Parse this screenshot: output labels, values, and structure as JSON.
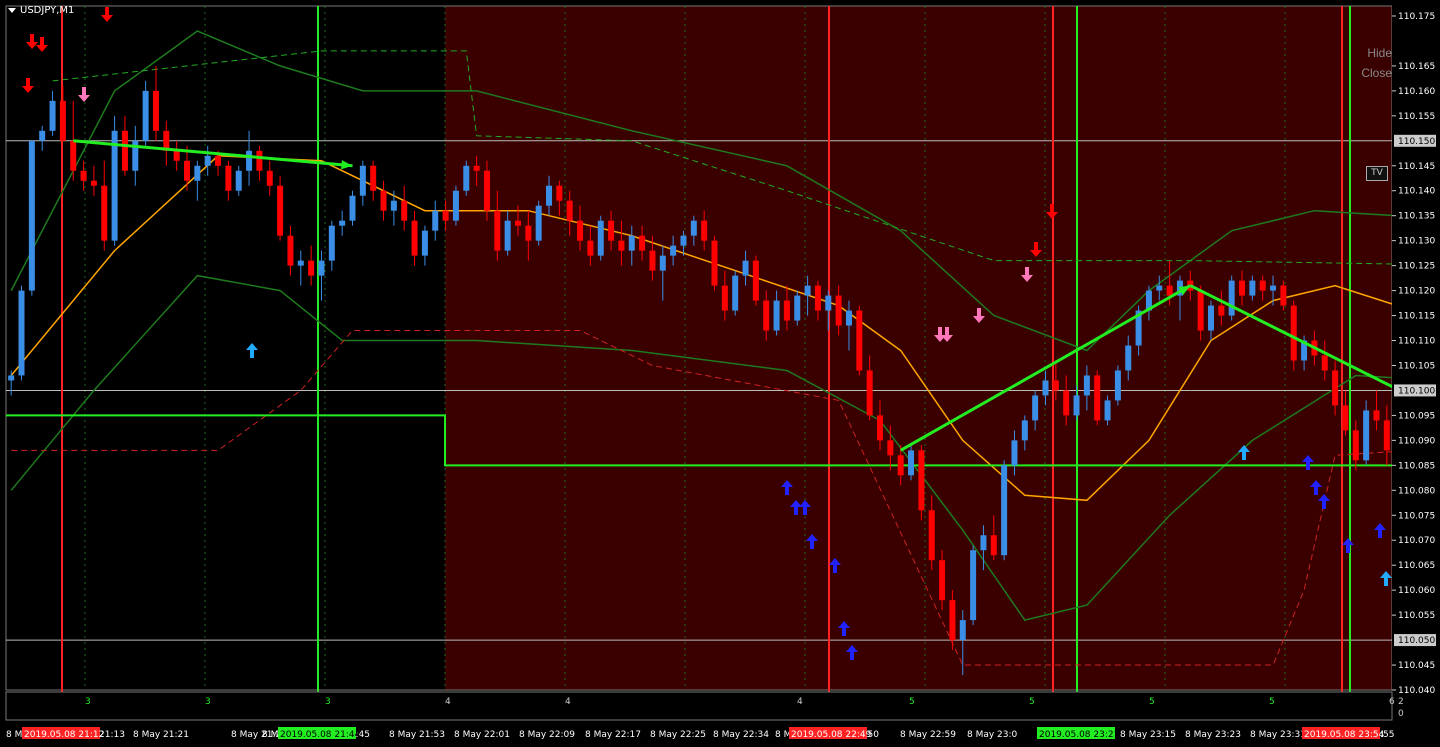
{
  "window": {
    "symbol_label": "USDJPY,M1"
  },
  "overlay_links": {
    "hide": "Hide",
    "close": "Close"
  },
  "tv_badge": "TV",
  "colors": {
    "background": "#000000",
    "shaded_bg": "#3a0000",
    "bull_candle": "#3a8ee6",
    "bear_candle": "#ff0000",
    "ma_orange": "#ffa500",
    "band_green": "#1e7a1e",
    "highlight_green": "#22ee22",
    "marker_red": "#ff0000",
    "marker_blue": "#2222ff",
    "marker_cyan": "#22aaff",
    "marker_pink": "#ff77bb"
  },
  "chart_data": {
    "type": "candlestick",
    "symbol": "USDJPY",
    "timeframe": "M1",
    "ylim": [
      110.04,
      110.177
    ],
    "y_ticks": [
      "110.175",
      "110.165",
      "110.160",
      "110.155",
      "110.145",
      "110.140",
      "110.135",
      "110.130",
      "110.125",
      "110.120",
      "110.115",
      "110.110",
      "110.105",
      "110.095",
      "110.090",
      "110.085",
      "110.080",
      "110.075",
      "110.070",
      "110.065",
      "110.060",
      "110.055",
      "110.045",
      "110.040"
    ],
    "horizontal_levels": [
      "110.150",
      "110.100",
      "110.050"
    ],
    "x_tick_labels": [
      "8 M",
      "21:13",
      "8 May 21:21",
      "8 May 21:29",
      "8 M",
      "21:45",
      "8 May 21:53",
      "8 May 22:01",
      "8 May 22:09",
      "8 May 22:17",
      "8 May 22:25",
      "8 May 22:34",
      "8 M",
      "22:50",
      "8 May 22:59",
      "8 May 23:0",
      "8 May 23:15",
      "8 May 23:23",
      "8 May 23:31",
      "8 May 23:39",
      "8 M",
      ":55"
    ],
    "highlighted_times": [
      "2019.05.08 21:12",
      "2019.05.08 21:44",
      "2019.05.08 22:49",
      "2019.05.08 23:21",
      "2019.05.08 23:54"
    ],
    "sub_indicator_labels": [
      "3",
      "3",
      "3",
      "4",
      "4",
      "4",
      "5",
      "5",
      "5",
      "5",
      "6",
      "2",
      "0"
    ],
    "ohlc": [
      [
        110.102,
        110.104,
        110.099,
        110.103
      ],
      [
        110.103,
        110.121,
        110.102,
        110.12
      ],
      [
        110.12,
        110.15,
        110.119,
        110.15
      ],
      [
        110.15,
        110.153,
        110.148,
        110.152
      ],
      [
        110.152,
        110.16,
        110.151,
        110.158
      ],
      [
        110.158,
        110.161,
        110.15,
        110.15
      ],
      [
        110.15,
        110.158,
        110.142,
        110.144
      ],
      [
        110.144,
        110.146,
        110.14,
        110.142
      ],
      [
        110.142,
        110.145,
        110.139,
        110.141
      ],
      [
        110.141,
        110.146,
        110.128,
        110.13
      ],
      [
        110.13,
        110.155,
        110.129,
        110.152
      ],
      [
        110.152,
        110.155,
        110.143,
        110.144
      ],
      [
        110.144,
        110.153,
        110.141,
        110.15
      ],
      [
        110.15,
        110.162,
        110.149,
        110.16
      ],
      [
        110.16,
        110.165,
        110.15,
        110.152
      ],
      [
        110.152,
        110.154,
        110.145,
        110.148
      ],
      [
        110.148,
        110.15,
        110.144,
        110.146
      ],
      [
        110.146,
        110.149,
        110.14,
        110.142
      ],
      [
        110.142,
        110.146,
        110.138,
        110.145
      ],
      [
        110.145,
        110.149,
        110.143,
        110.147
      ],
      [
        110.147,
        110.148,
        110.143,
        110.145
      ],
      [
        110.145,
        110.146,
        110.138,
        110.14
      ],
      [
        110.14,
        110.145,
        110.139,
        110.144
      ],
      [
        110.144,
        110.152,
        110.141,
        110.148
      ],
      [
        110.148,
        110.149,
        110.142,
        110.144
      ],
      [
        110.144,
        110.146,
        110.139,
        110.141
      ],
      [
        110.141,
        110.143,
        110.13,
        110.131
      ],
      [
        110.131,
        110.133,
        110.123,
        110.125
      ],
      [
        110.125,
        110.128,
        110.121,
        110.126
      ],
      [
        110.126,
        110.129,
        110.121,
        110.123
      ],
      [
        110.123,
        110.128,
        110.118,
        110.126
      ],
      [
        110.126,
        110.134,
        110.124,
        110.133
      ],
      [
        110.133,
        110.136,
        110.131,
        110.134
      ],
      [
        110.134,
        110.14,
        110.133,
        110.139
      ],
      [
        110.139,
        110.146,
        110.137,
        110.145
      ],
      [
        110.145,
        110.146,
        110.138,
        110.14
      ],
      [
        110.14,
        110.142,
        110.134,
        110.136
      ],
      [
        110.136,
        110.14,
        110.133,
        110.138
      ],
      [
        110.138,
        110.141,
        110.132,
        110.134
      ],
      [
        110.134,
        110.136,
        110.125,
        110.127
      ],
      [
        110.127,
        110.133,
        110.125,
        110.132
      ],
      [
        110.132,
        110.138,
        110.13,
        110.136
      ],
      [
        110.136,
        110.138,
        110.132,
        110.134
      ],
      [
        110.134,
        110.141,
        110.133,
        110.14
      ],
      [
        110.14,
        110.146,
        110.139,
        110.145
      ],
      [
        110.145,
        110.147,
        110.141,
        110.144
      ],
      [
        110.144,
        110.146,
        110.134,
        110.136
      ],
      [
        110.136,
        110.14,
        110.126,
        110.128
      ],
      [
        110.128,
        110.136,
        110.127,
        110.134
      ],
      [
        110.134,
        110.137,
        110.131,
        110.133
      ],
      [
        110.133,
        110.136,
        110.126,
        110.13
      ],
      [
        110.13,
        110.138,
        110.129,
        110.137
      ],
      [
        110.137,
        110.143,
        110.135,
        110.141
      ],
      [
        110.141,
        110.142,
        110.135,
        110.138
      ],
      [
        110.138,
        110.14,
        110.131,
        110.134
      ],
      [
        110.134,
        110.137,
        110.128,
        110.13
      ],
      [
        110.13,
        110.133,
        110.125,
        110.127
      ],
      [
        110.127,
        110.135,
        110.126,
        110.134
      ],
      [
        110.134,
        110.136,
        110.128,
        110.13
      ],
      [
        110.13,
        110.134,
        110.125,
        110.128
      ],
      [
        110.128,
        110.133,
        110.125,
        110.131
      ],
      [
        110.131,
        110.133,
        110.126,
        110.128
      ],
      [
        110.128,
        110.131,
        110.122,
        110.124
      ],
      [
        110.124,
        110.129,
        110.118,
        110.127
      ],
      [
        110.127,
        110.131,
        110.125,
        110.129
      ],
      [
        110.129,
        110.132,
        110.127,
        110.131
      ],
      [
        110.131,
        110.135,
        110.129,
        110.134
      ],
      [
        110.134,
        110.136,
        110.128,
        110.13
      ],
      [
        110.13,
        110.131,
        110.12,
        110.121
      ],
      [
        110.121,
        110.124,
        110.114,
        110.116
      ],
      [
        110.116,
        110.124,
        110.115,
        110.123
      ],
      [
        110.123,
        110.128,
        110.121,
        110.126
      ],
      [
        110.126,
        110.127,
        110.117,
        110.118
      ],
      [
        110.118,
        110.12,
        110.11,
        110.112
      ],
      [
        110.112,
        110.12,
        110.111,
        110.118
      ],
      [
        110.118,
        110.121,
        110.112,
        110.114
      ],
      [
        110.114,
        110.12,
        110.113,
        110.119
      ],
      [
        110.119,
        110.123,
        110.115,
        110.121
      ],
      [
        110.121,
        110.122,
        110.114,
        110.116
      ],
      [
        110.116,
        110.12,
        110.112,
        110.119
      ],
      [
        110.119,
        110.121,
        110.111,
        110.113
      ],
      [
        110.113,
        110.118,
        110.108,
        110.116
      ],
      [
        110.116,
        110.117,
        110.103,
        110.104
      ],
      [
        110.104,
        110.107,
        110.094,
        110.095
      ],
      [
        110.095,
        110.098,
        110.088,
        110.09
      ],
      [
        110.09,
        110.093,
        110.084,
        110.087
      ],
      [
        110.087,
        110.089,
        110.081,
        110.083
      ],
      [
        110.083,
        110.089,
        110.082,
        110.088
      ],
      [
        110.088,
        110.089,
        110.074,
        110.076
      ],
      [
        110.076,
        110.079,
        110.064,
        110.066
      ],
      [
        110.066,
        110.068,
        110.056,
        110.058
      ],
      [
        110.058,
        110.06,
        110.048,
        110.05
      ],
      [
        110.05,
        110.056,
        110.043,
        110.054
      ],
      [
        110.054,
        110.069,
        110.053,
        110.068
      ],
      [
        110.068,
        110.073,
        110.064,
        110.071
      ],
      [
        110.071,
        110.075,
        110.066,
        110.067
      ],
      [
        110.067,
        110.086,
        110.066,
        110.085
      ],
      [
        110.085,
        110.092,
        110.083,
        110.09
      ],
      [
        110.09,
        110.095,
        110.088,
        110.094
      ],
      [
        110.094,
        110.1,
        110.092,
        110.099
      ],
      [
        110.099,
        110.104,
        110.097,
        110.102
      ],
      [
        110.102,
        110.106,
        110.098,
        110.1
      ],
      [
        110.1,
        110.103,
        110.093,
        110.095
      ],
      [
        110.095,
        110.101,
        110.094,
        110.099
      ],
      [
        110.099,
        110.105,
        110.096,
        110.103
      ],
      [
        110.103,
        110.104,
        110.093,
        110.094
      ],
      [
        110.094,
        110.099,
        110.093,
        110.098
      ],
      [
        110.098,
        110.105,
        110.097,
        110.104
      ],
      [
        110.104,
        110.111,
        110.102,
        110.109
      ],
      [
        110.109,
        110.117,
        110.107,
        110.116
      ],
      [
        110.116,
        110.121,
        110.114,
        110.12
      ],
      [
        110.12,
        110.123,
        110.118,
        110.121
      ],
      [
        110.121,
        110.126,
        110.117,
        110.119
      ],
      [
        110.119,
        110.123,
        110.114,
        110.122
      ],
      [
        110.122,
        110.124,
        110.118,
        110.12
      ],
      [
        110.12,
        110.121,
        110.11,
        110.112
      ],
      [
        110.112,
        110.118,
        110.11,
        110.117
      ],
      [
        110.117,
        110.12,
        110.113,
        110.115
      ],
      [
        110.115,
        110.123,
        110.114,
        110.122
      ],
      [
        110.122,
        110.124,
        110.117,
        110.119
      ],
      [
        110.119,
        110.123,
        110.118,
        110.122
      ],
      [
        110.122,
        110.123,
        110.118,
        110.12
      ],
      [
        110.12,
        110.123,
        110.117,
        110.121
      ],
      [
        110.121,
        110.122,
        110.116,
        110.117
      ],
      [
        110.117,
        110.118,
        110.104,
        110.106
      ],
      [
        110.106,
        110.111,
        110.104,
        110.11
      ],
      [
        110.11,
        110.112,
        110.105,
        110.107
      ],
      [
        110.107,
        110.11,
        110.102,
        110.104
      ],
      [
        110.104,
        110.106,
        110.095,
        110.097
      ],
      [
        110.097,
        110.1,
        110.091,
        110.092
      ],
      [
        110.092,
        110.094,
        110.084,
        110.086
      ],
      [
        110.086,
        110.098,
        110.085,
        110.096
      ],
      [
        110.096,
        110.1,
        110.092,
        110.094
      ],
      [
        110.094,
        110.097,
        110.085,
        110.088
      ]
    ],
    "indicator_lines": [
      {
        "name": "",
        "color": "#ffa500",
        "points": [
          [
            0,
            110.103
          ],
          [
            10,
            110.128
          ],
          [
            20,
            110.147
          ],
          [
            30,
            110.146
          ],
          [
            40,
            110.136
          ],
          [
            50,
            110.136
          ],
          [
            60,
            110.131
          ],
          [
            70,
            110.124
          ],
          [
            80,
            110.117
          ],
          [
            86,
            110.108
          ],
          [
            92,
            110.09
          ],
          [
            98,
            110.079
          ],
          [
            104,
            110.078
          ],
          [
            110,
            110.09
          ],
          [
            116,
            110.11
          ],
          [
            122,
            110.118
          ],
          [
            128,
            110.121
          ],
          [
            134,
            110.117
          ],
          [
            140,
            110.108
          ],
          [
            143,
            110.098
          ]
        ]
      },
      {
        "name": "",
        "color": "#1e7a1e",
        "points": [
          [
            0,
            110.12
          ],
          [
            10,
            110.16
          ],
          [
            18,
            110.172
          ],
          [
            26,
            110.165
          ],
          [
            34,
            110.16
          ],
          [
            45,
            110.16
          ],
          [
            60,
            110.152
          ],
          [
            75,
            110.145
          ],
          [
            86,
            110.132
          ],
          [
            95,
            110.115
          ],
          [
            104,
            110.108
          ],
          [
            110,
            110.12
          ],
          [
            118,
            110.132
          ],
          [
            126,
            110.136
          ],
          [
            134,
            110.135
          ],
          [
            143,
            110.121
          ]
        ]
      },
      {
        "name": "",
        "color": "#1e7a1e",
        "points": [
          [
            0,
            110.08
          ],
          [
            8,
            110.1
          ],
          [
            18,
            110.123
          ],
          [
            26,
            110.12
          ],
          [
            32,
            110.11
          ],
          [
            45,
            110.11
          ],
          [
            60,
            110.108
          ],
          [
            75,
            110.104
          ],
          [
            84,
            110.094
          ],
          [
            92,
            110.072
          ],
          [
            98,
            110.054
          ],
          [
            104,
            110.057
          ],
          [
            112,
            110.075
          ],
          [
            120,
            110.09
          ],
          [
            130,
            110.103
          ],
          [
            138,
            110.102
          ],
          [
            143,
            110.085
          ]
        ]
      }
    ],
    "green_arrows": [
      {
        "from": [
          6,
          110.15
        ],
        "to": [
          33,
          110.145
        ]
      },
      {
        "from": [
          86,
          110.088
        ],
        "to": [
          114,
          110.121
        ]
      },
      {
        "from": [
          114,
          110.121
        ],
        "to": [
          141,
          110.093
        ]
      }
    ]
  }
}
